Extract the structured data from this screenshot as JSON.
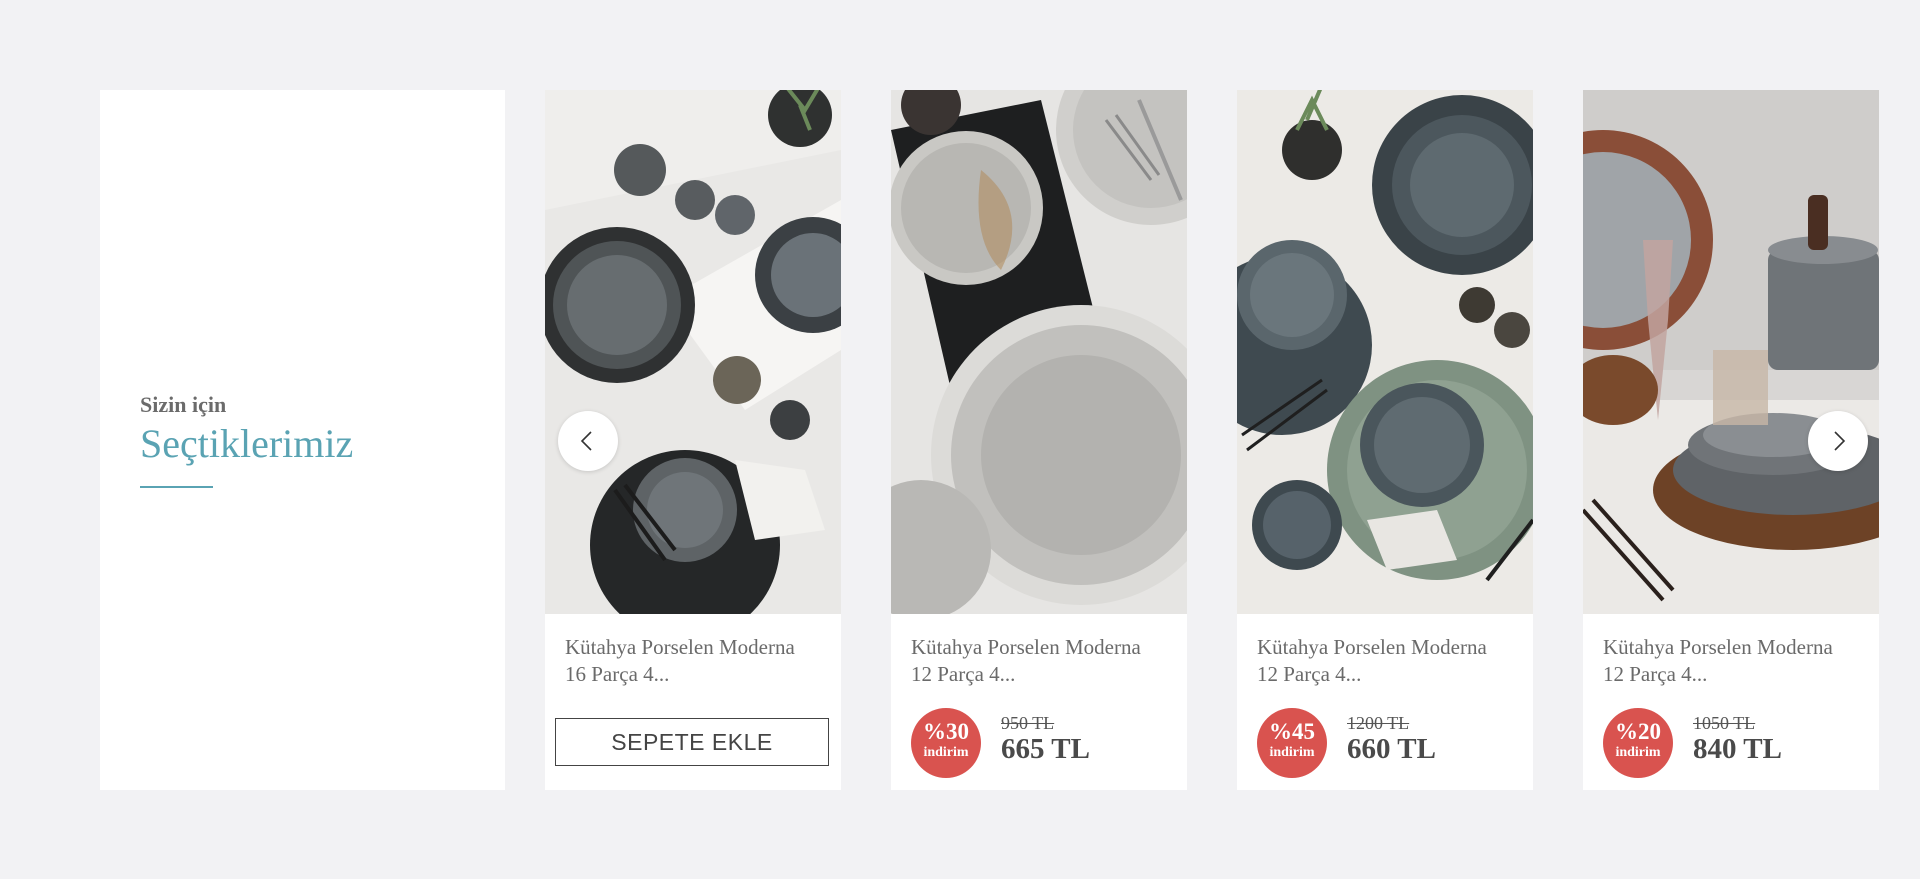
{
  "section": {
    "kicker": "Sizin için",
    "headline": "Seçtiklerimiz"
  },
  "navigation": {
    "prev_icon": "chevron-left-icon",
    "next_icon": "chevron-right-icon"
  },
  "colors": {
    "accent": "#5aa3b3",
    "discount_badge": "#d9534f",
    "page_background": "#f2f2f4"
  },
  "products": [
    {
      "title_line1": "Kütahya Porselen Moderna",
      "title_line2": "16 Parça 4...",
      "button_label": "SEPETE EKLE"
    },
    {
      "title_line1": "Kütahya Porselen Moderna",
      "title_line2": "12 Parça 4...",
      "discount": "%30",
      "discount_label": "indirim",
      "old_price": "950 TL",
      "price": "665 TL"
    },
    {
      "title_line1": "Kütahya Porselen Moderna",
      "title_line2": "12 Parça 4...",
      "discount": "%45",
      "discount_label": "indirim",
      "old_price": "1200 TL",
      "price": "660 TL"
    },
    {
      "title_line1": "Kütahya Porselen Moderna",
      "title_line2": "12 Parça 4...",
      "discount": "%20",
      "discount_label": "indirim",
      "old_price": "1050 TL",
      "price": "840 TL"
    }
  ]
}
